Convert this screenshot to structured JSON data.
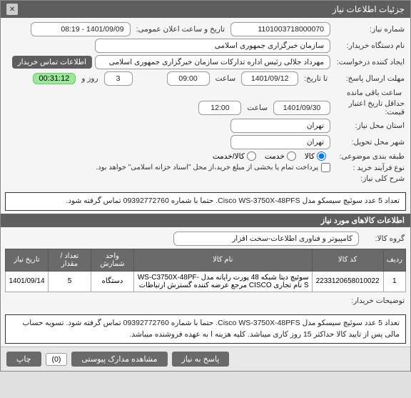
{
  "title": "جزئیات اطلاعات نیاز",
  "close": "✕",
  "labels": {
    "req_no": "شماره نیاز:",
    "org": "نام دستگاه خریدار:",
    "creator": "ایجاد کننده درخواست:",
    "contact_btn": "اطلاعات تماس خریدار",
    "reply_deadline": "مهلت ارسال پاسخ:",
    "to_date": "تا تاریخ:",
    "hour": "ساعت",
    "days_and": "روز و",
    "remaining": "ساعت باقی مانده",
    "price_valid": "حداقل تاریخ اعتبار قیمت:",
    "req_city": "استان محل نیاز:",
    "deliver_city": "شهر محل تحویل:",
    "category": "طبقه بندی موضوعی:",
    "buy_process": "نوع فرآیند خرید :",
    "payment_note": "پرداخت تمام یا بخشی از مبلغ خرید،از محل \"اسناد خزانه اسلامی\" خواهد بود.",
    "radio_goods": "کالا",
    "radio_service": "خدمت",
    "radio_both": "کالا/خدمت",
    "desc_label": "شرح کلی نیاز:",
    "section2": "اطلاعات کالاهای مورد نیاز",
    "group_label": "گروه کالا:",
    "th_row": "ردیف",
    "th_code": "کد کالا",
    "th_name": "نام کالا",
    "th_unit": "واحد شمارش",
    "th_qty": "تعداد / مقدار",
    "th_date": "تاریخ نیاز",
    "buyer_notes": "توضیحات خریدار:",
    "btn_reply": "پاسخ به نیاز",
    "btn_attach": "مشاهده مدارک پیوستی",
    "btn_print": "چاپ"
  },
  "values": {
    "req_no": "1101003718000070",
    "announce_label": "تاریخ و ساعت اعلان عمومی:",
    "announce_val": "1401/09/09 - 08:19",
    "org": "سازمان خبرگزاری جمهوری اسلامی",
    "creator": "مهرداد جلالی رئیس اداره تدارکات سازمان خبرگزاری جمهوری اسلامی",
    "from_date": "1401/09/12",
    "from_hour": "09:00",
    "days": "3",
    "timer": "00:31:12",
    "price_date": "1401/09/30",
    "price_hour": "12:00",
    "req_city": "تهران",
    "deliver_city": "تهران",
    "desc": "تعداد 5 عدد سوئیچ سیسکو مدل Cisco WS-3750X-48PFS. حتما با شماره 09392772760 تماس گرفته شود.",
    "group": "کامپیوتر و فناوری اطلاعات-سخت افزار",
    "notes": "تعداد 5 عدد سوئیچ سیسکو مدل Cisco WS-3750X-48PFS. حتما با شماره 09392772760 تماس گرفته شود. تسویه حساب مالی پس از تایید کالا حداکثر 15 روز کاری میباشد. کلیه هزینه ا به عهده فروشنده میباشد.",
    "attach_count": "(0)"
  },
  "table": {
    "rows": [
      {
        "idx": "1",
        "code": "2233120658010022",
        "name": "سوئیچ دیتا شبکه 48 پورت رایانه مدل WS-C3750X-48PF-S نام تجاری CISCO مرجع عرضه کننده گسترش ارتباطات",
        "unit": "دستگاه",
        "qty": "5",
        "date": "1401/09/14"
      }
    ]
  }
}
